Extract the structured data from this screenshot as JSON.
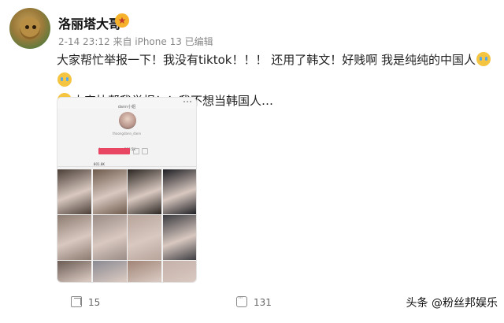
{
  "post": {
    "username": "洛丽塔大哥",
    "badge_icon": "gold-star-badge-icon",
    "meta": "2-14 23:12 来自 iPhone 13 已编辑",
    "text_line1": "大家帮忙举报一下！我没有tiktok！！！ 还用了韩文！好贱啊 我是纯纯的中国人",
    "text_line2": "大家快帮我举报！！我不想当韩国人…",
    "emoji_name": "crying-emoji"
  },
  "screenshot": {
    "profile_name": "dann小姐",
    "handle": "thaongdann_dann",
    "stats": [
      "4",
      "218.5K",
      "801.8K"
    ],
    "cell_colors": [
      "#4a3e36",
      "#6e5a4c",
      "#2a2420",
      "#1d1d22",
      "#8c7b70",
      "#9a8c86",
      "#b7a49b",
      "#3b3b40",
      "#6a5b54",
      "#8a8a92",
      "#a08476",
      "#c4b0a8"
    ]
  },
  "actions": {
    "share_count": "15",
    "comment_count": "131"
  },
  "watermark": "头条 @粉丝邦娱乐"
}
